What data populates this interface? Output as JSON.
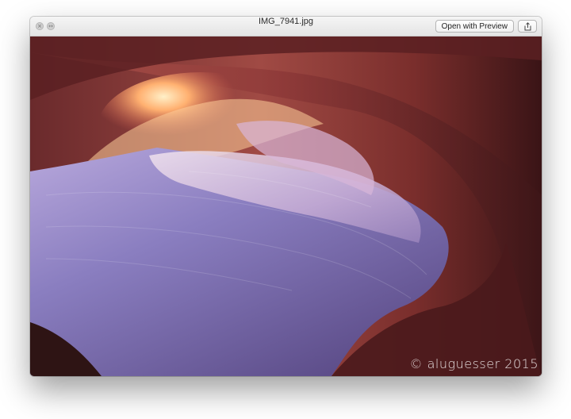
{
  "window": {
    "title": "IMG_7941.jpg",
    "open_button_label": "Open with Preview"
  },
  "icons": {
    "close": "close-icon",
    "zoom": "zoom-icon",
    "share": "share-icon"
  },
  "photo": {
    "watermark": "© aluguesser 2015",
    "colors": {
      "sky_glow": "#ffb070",
      "rock_dark": "#4a1a1c",
      "rock_mid": "#9a4a44",
      "rock_violet": "#8b80c0",
      "rock_light": "#e2d2ea"
    }
  }
}
